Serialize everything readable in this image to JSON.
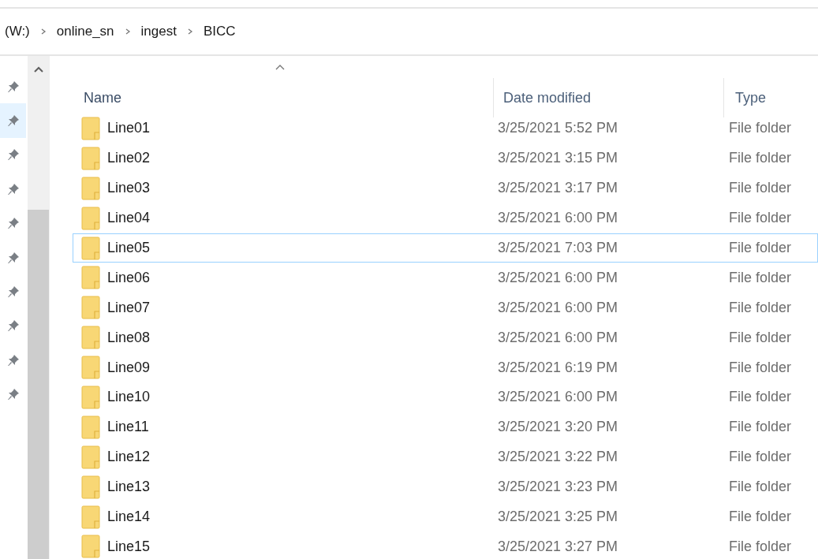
{
  "breadcrumb": [
    "(W:)",
    "online_sn",
    "ingest",
    "BICC"
  ],
  "quick_access": [
    {
      "selected": false
    },
    {
      "selected": true
    },
    {
      "selected": false
    },
    {
      "selected": false
    },
    {
      "selected": false
    },
    {
      "selected": false
    },
    {
      "selected": false
    },
    {
      "selected": false
    },
    {
      "selected": false
    },
    {
      "selected": false
    }
  ],
  "table": {
    "columns": [
      {
        "label": "Name",
        "sorted": true
      },
      {
        "label": "Date modified",
        "sorted": false
      },
      {
        "label": "Type",
        "sorted": false
      }
    ],
    "rows": [
      {
        "name": "Line01",
        "date": "3/25/2021 5:52 PM",
        "type": "File folder",
        "focused": false
      },
      {
        "name": "Line02",
        "date": "3/25/2021 3:15 PM",
        "type": "File folder",
        "focused": false
      },
      {
        "name": "Line03",
        "date": "3/25/2021 3:17 PM",
        "type": "File folder",
        "focused": false
      },
      {
        "name": "Line04",
        "date": "3/25/2021 6:00 PM",
        "type": "File folder",
        "focused": false
      },
      {
        "name": "Line05",
        "date": "3/25/2021 7:03 PM",
        "type": "File folder",
        "focused": true
      },
      {
        "name": "Line06",
        "date": "3/25/2021 6:00 PM",
        "type": "File folder",
        "focused": false
      },
      {
        "name": "Line07",
        "date": "3/25/2021 6:00 PM",
        "type": "File folder",
        "focused": false
      },
      {
        "name": "Line08",
        "date": "3/25/2021 6:00 PM",
        "type": "File folder",
        "focused": false
      },
      {
        "name": "Line09",
        "date": "3/25/2021 6:19 PM",
        "type": "File folder",
        "focused": false
      },
      {
        "name": "Line10",
        "date": "3/25/2021 6:00 PM",
        "type": "File folder",
        "focused": false
      },
      {
        "name": "Line11",
        "date": "3/25/2021 3:20 PM",
        "type": "File folder",
        "focused": false
      },
      {
        "name": "Line12",
        "date": "3/25/2021 3:22 PM",
        "type": "File folder",
        "focused": false
      },
      {
        "name": "Line13",
        "date": "3/25/2021 3:23 PM",
        "type": "File folder",
        "focused": false
      },
      {
        "name": "Line14",
        "date": "3/25/2021 3:25 PM",
        "type": "File folder",
        "focused": false
      },
      {
        "name": "Line15",
        "date": "3/25/2021 3:27 PM",
        "type": "File folder",
        "focused": false
      }
    ]
  }
}
